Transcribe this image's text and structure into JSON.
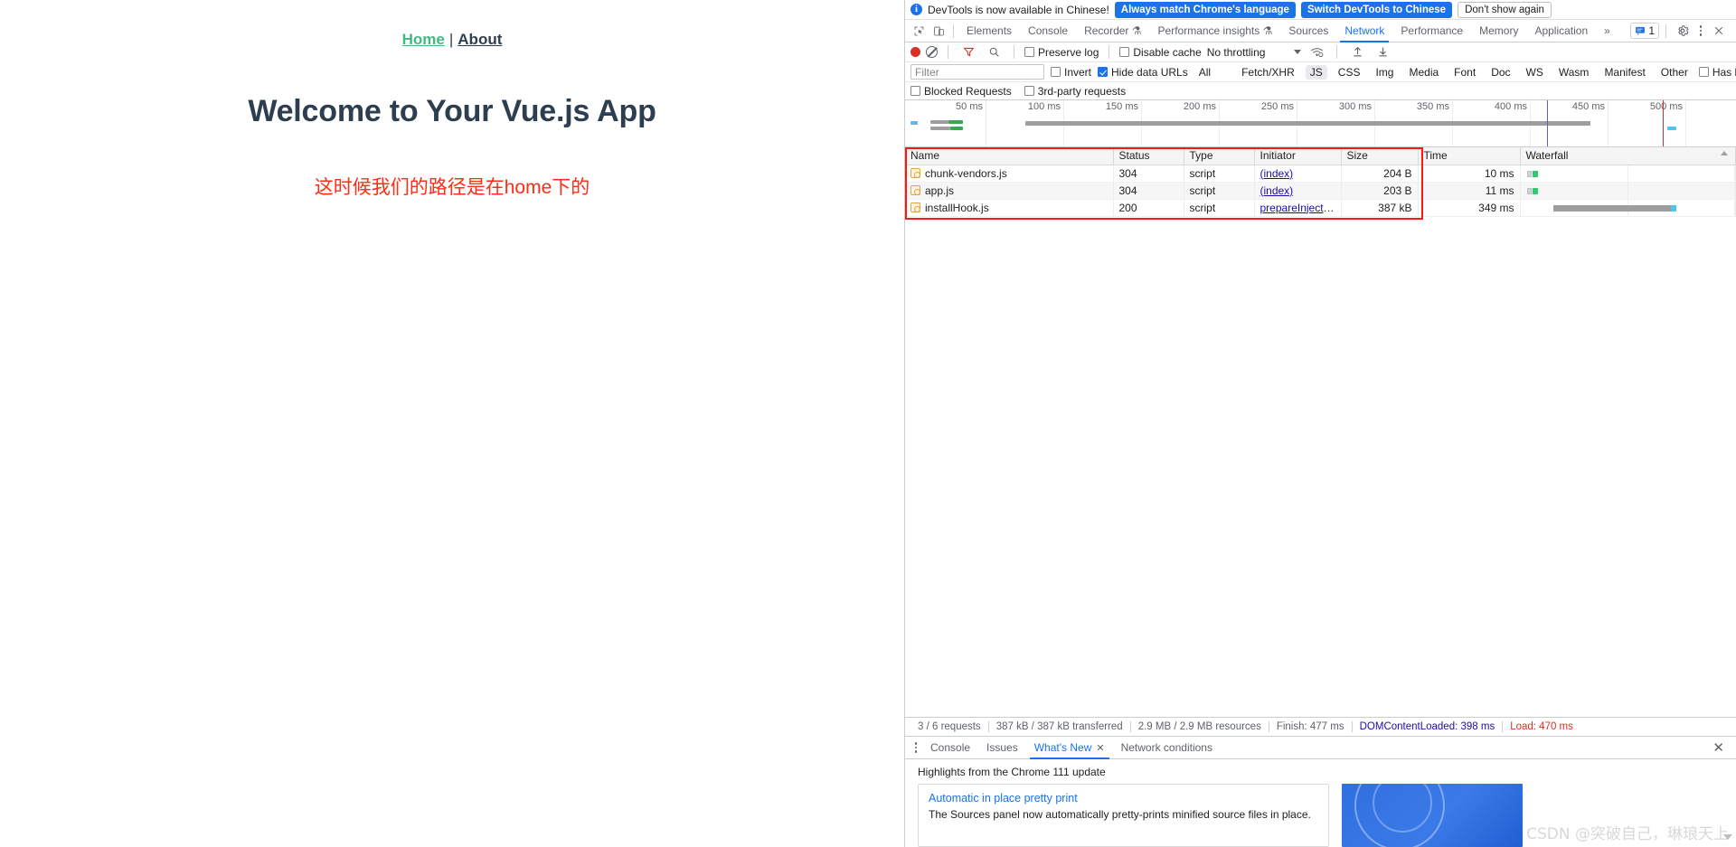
{
  "page": {
    "nav": {
      "home": "Home",
      "separator": "|",
      "about": "About"
    },
    "title": "Welcome to Your Vue.js App",
    "message": "这时候我们的路径是在home下的"
  },
  "devtools": {
    "banner": {
      "icon": "info-icon",
      "text": "DevTools is now available in Chinese!",
      "btn_always": "Always match Chrome's language",
      "btn_switch": "Switch DevTools to Chinese",
      "btn_dismiss": "Don't show again"
    },
    "tabs": [
      {
        "label": "Elements",
        "selected": false
      },
      {
        "label": "Console",
        "selected": false
      },
      {
        "label": "Recorder",
        "selected": false,
        "badge": "experiment"
      },
      {
        "label": "Performance insights",
        "selected": false,
        "badge": "experiment"
      },
      {
        "label": "Sources",
        "selected": false
      },
      {
        "label": "Network",
        "selected": true
      },
      {
        "label": "Performance",
        "selected": false
      },
      {
        "label": "Memory",
        "selected": false
      },
      {
        "label": "Application",
        "selected": false
      }
    ],
    "tabs_more": "»",
    "issues_count": "1",
    "toolbar": {
      "record_title": "record",
      "clear_title": "clear",
      "filter_title": "filter",
      "search_title": "search",
      "preserve_log": "Preserve log",
      "preserve_log_checked": false,
      "disable_cache": "Disable cache",
      "disable_cache_checked": false,
      "throttling": "No throttling",
      "import_title": "import-har",
      "export_title": "export-har"
    },
    "filterbar": {
      "filter_placeholder": "Filter",
      "filter_value": "",
      "invert": "Invert",
      "invert_checked": false,
      "hide_data_urls": "Hide data URLs",
      "hide_data_urls_checked": true,
      "types": [
        {
          "label": "All",
          "active": false
        },
        {
          "label": "Fetch/XHR",
          "active": false
        },
        {
          "label": "JS",
          "active": true
        },
        {
          "label": "CSS",
          "active": false
        },
        {
          "label": "Img",
          "active": false
        },
        {
          "label": "Media",
          "active": false
        },
        {
          "label": "Font",
          "active": false
        },
        {
          "label": "Doc",
          "active": false
        },
        {
          "label": "WS",
          "active": false
        },
        {
          "label": "Wasm",
          "active": false
        },
        {
          "label": "Manifest",
          "active": false
        },
        {
          "label": "Other",
          "active": false
        }
      ],
      "has_blocked_cookies": "Has blocked cookies",
      "has_blocked_cookies_checked": false,
      "blocked_requests": "Blocked Requests",
      "blocked_requests_checked": false,
      "third_party": "3rd-party requests",
      "third_party_checked": false
    },
    "overview": {
      "ticks": [
        "50 ms",
        "100 ms",
        "150 ms",
        "200 ms",
        "250 ms",
        "300 ms",
        "350 ms",
        "400 ms",
        "450 ms",
        "500 ms"
      ],
      "dom_content_loaded_color": "#1a0dab",
      "load_color": "#d93025"
    },
    "table": {
      "columns": [
        "Name",
        "Status",
        "Type",
        "Initiator",
        "Size",
        "Time",
        "Waterfall"
      ],
      "rows": [
        {
          "name": "chunk-vendors.js",
          "status": "304",
          "type": "script",
          "initiator": "(index)",
          "size": "204 B",
          "time": "10 ms"
        },
        {
          "name": "app.js",
          "status": "304",
          "type": "script",
          "initiator": "(index)",
          "size": "203 B",
          "time": "11 ms"
        },
        {
          "name": "installHook.js",
          "status": "200",
          "type": "script",
          "initiator": "prepareInjection.j…",
          "size": "387 kB",
          "time": "349 ms"
        }
      ]
    },
    "statusbar": {
      "requests": "3 / 6 requests",
      "transferred": "387 kB / 387 kB transferred",
      "resources": "2.9 MB / 2.9 MB resources",
      "finish": "Finish: 477 ms",
      "dcl": "DOMContentLoaded: 398 ms",
      "load": "Load: 470 ms"
    },
    "drawer": {
      "tabs": [
        {
          "label": "Console",
          "selected": false,
          "closable": false
        },
        {
          "label": "Issues",
          "selected": false,
          "closable": false
        },
        {
          "label": "What's New",
          "selected": true,
          "closable": true
        },
        {
          "label": "Network conditions",
          "selected": false,
          "closable": false
        }
      ],
      "heading": "Highlights from the Chrome 111 update",
      "card": {
        "title": "Automatic in place pretty print",
        "description": "The Sources panel now automatically pretty-prints minified source files in place."
      }
    }
  },
  "watermark": "CSDN @突破自己，琳琅天上"
}
